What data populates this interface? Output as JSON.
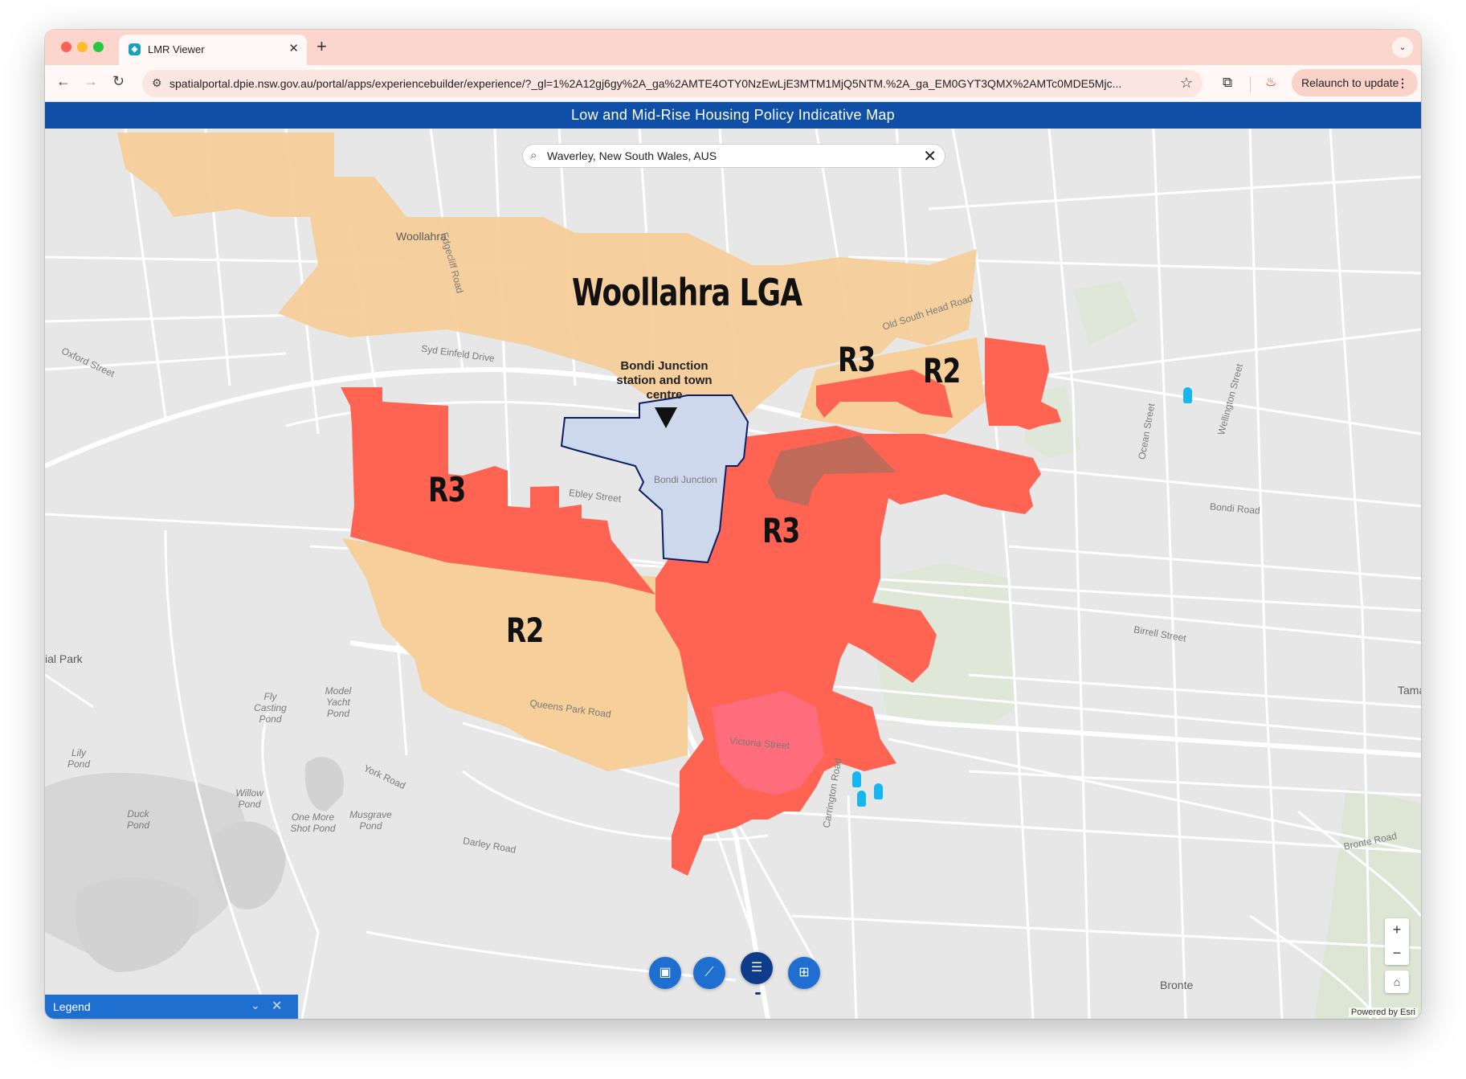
{
  "browser": {
    "tab_title": "LMR Viewer",
    "url": "spatialportal.dpie.nsw.gov.au/portal/apps/experiencebuilder/experience/?_gl=1%2A12gj6gy%2A_ga%2AMTE4OTY0NzEwLjE3MTM1MjQ5NTM.%2A_ga_EM0GYT3QMX%2AMTc0MDE5Mjc...",
    "relaunch_label": "Relaunch to update"
  },
  "app": {
    "title": "Low and Mid-Rise Housing Policy Indicative Map"
  },
  "search": {
    "value": "Waverley, New South Wales, AUS"
  },
  "map": {
    "lga_label": "Woollahra LGA",
    "station_note": "Bondi Junction station and town centre",
    "zone_labels": {
      "r3_west": "R3",
      "r3_center": "R3",
      "r3_north": "R3",
      "r2_north": "R2",
      "r2_south": "R2"
    },
    "place_labels": {
      "woollahra": "Woollahra",
      "bondi_junction": "Bondi Junction",
      "ial_park": "ial Park",
      "tama": "Tama",
      "fly_casting_pond": "Fly Casting Pond",
      "model_yacht_pond": "Model Yacht Pond",
      "lily_pond": "Lily Pond",
      "willow_pond": "Willow Pond",
      "duck_pond": "Duck Pond",
      "one_more_shot_pond": "One More Shot Pond",
      "musgrave_pond": "Musgrave Pond",
      "bronte": "Bronte"
    },
    "street_labels": {
      "syd_einfeld_drive": "Syd Einfeld Drive",
      "oxford_street": "Oxford Street",
      "ebley_street": "Ebley Street",
      "bondi_road": "Bondi Road",
      "birrell_street": "Birrell Street",
      "old_south_head_road": "Old South Head Road",
      "queens_park_road": "Queens Park Road",
      "victoria_street": "Victoria Street",
      "york_road": "York Road",
      "carrington_road": "Carrington Road",
      "bronte_road": "Bronte Road",
      "darley_road": "Darley Road",
      "edgecliff_road": "Edgecliff Road",
      "ocean_street": "Ocean Street",
      "wellington_street": "Wellington Street"
    },
    "colors": {
      "r3": "#ff6352",
      "r2": "#f6cf9a",
      "town_centre": "#cdd8ec",
      "town_centre_border": "#0b1f66",
      "base": "#e7e7e7",
      "park": "#dfe8d8",
      "accent": "#1f6fd0"
    },
    "zoom_in": "+",
    "zoom_out": "−",
    "attribution": "Powered by Esri"
  },
  "tools": [
    "bookmark-icon",
    "measure-icon",
    "layer-list-icon",
    "basemap-gallery-icon"
  ],
  "legend": {
    "title": "Legend"
  }
}
